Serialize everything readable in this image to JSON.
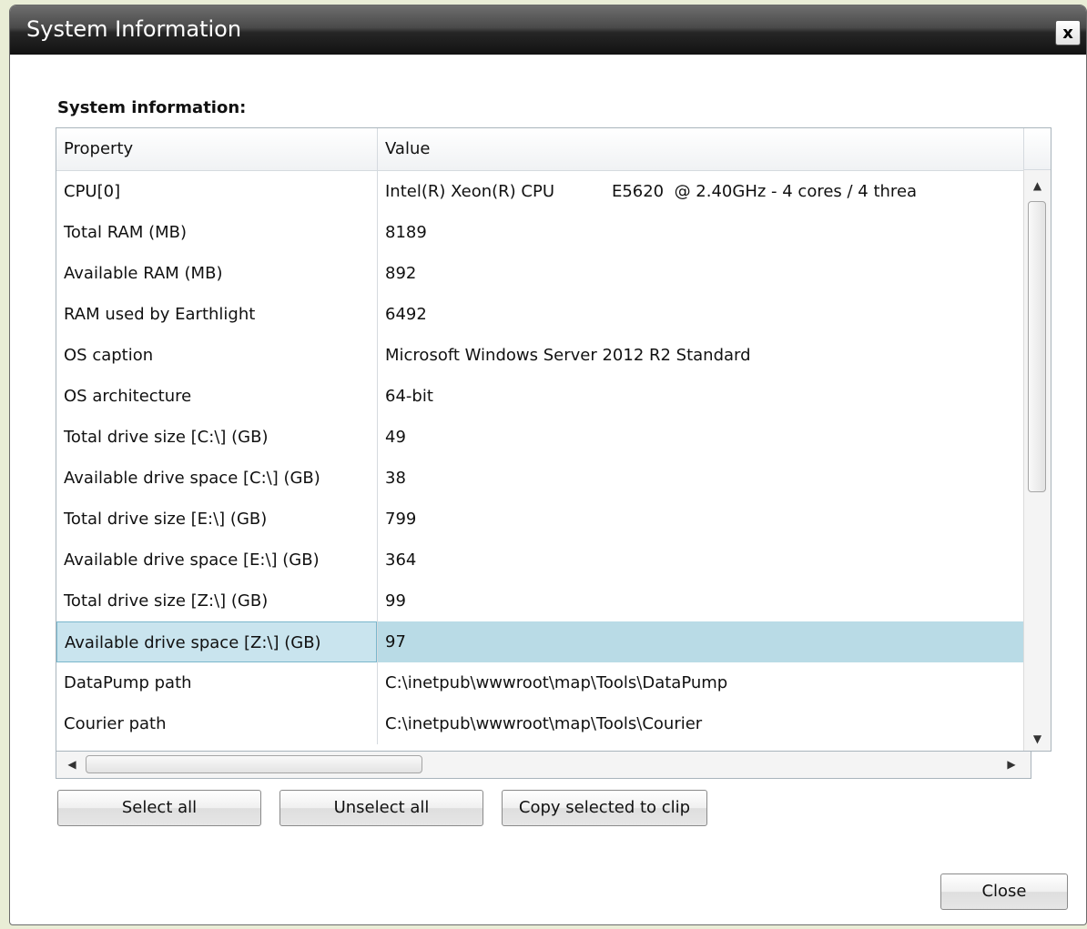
{
  "window": {
    "title": "System Information",
    "close_glyph": "x"
  },
  "section_label": "System information:",
  "table": {
    "columns": [
      "Property",
      "Value"
    ],
    "rows": [
      {
        "property": "CPU[0]",
        "value": "Intel(R) Xeon(R) CPU           E5620  @ 2.40GHz - 4 cores / 4 threa"
      },
      {
        "property": "Total RAM (MB)",
        "value": "8189"
      },
      {
        "property": "Available RAM (MB)",
        "value": "892"
      },
      {
        "property": "RAM used by Earthlight",
        "value": "6492"
      },
      {
        "property": "OS caption",
        "value": "Microsoft Windows Server 2012 R2 Standard"
      },
      {
        "property": "OS architecture",
        "value": "64-bit"
      },
      {
        "property": "Total drive size [C:\\] (GB)",
        "value": "49"
      },
      {
        "property": "Available drive space [C:\\] (GB)",
        "value": "38"
      },
      {
        "property": "Total drive size [E:\\] (GB)",
        "value": "799"
      },
      {
        "property": "Available drive space [E:\\] (GB)",
        "value": "364"
      },
      {
        "property": "Total drive size [Z:\\] (GB)",
        "value": "99"
      },
      {
        "property": "Available drive space [Z:\\] (GB)",
        "value": "97"
      },
      {
        "property": "DataPump path",
        "value": "C:\\inetpub\\wwwroot\\map\\Tools\\DataPump"
      },
      {
        "property": "Courier path",
        "value": "C:\\inetpub\\wwwroot\\map\\Tools\\Courier"
      }
    ],
    "selected_row": 11
  },
  "buttons": {
    "select_all": "Select all",
    "unselect_all": "Unselect all",
    "copy_selected": "Copy selected to clip",
    "close": "Close"
  },
  "icons": {
    "scroll_up": "▲",
    "scroll_down": "▼",
    "scroll_left": "◀",
    "scroll_right": "▶"
  },
  "colors": {
    "selection": "#b9dbe6",
    "titlebar": "#262626"
  }
}
